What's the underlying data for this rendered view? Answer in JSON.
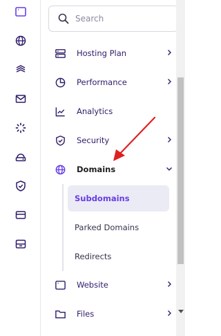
{
  "rail": {
    "icons": [
      "browser-window-icon",
      "globe-icon",
      "layers-icon",
      "mail-icon",
      "loader-icon",
      "cloud-drive-icon",
      "shield-icon",
      "card-icon",
      "storage-box-icon"
    ]
  },
  "search": {
    "placeholder": "Search",
    "value": ""
  },
  "nav": {
    "hosting_plan": "Hosting Plan",
    "performance": "Performance",
    "analytics": "Analytics",
    "security": "Security",
    "domains": "Domains",
    "website": "Website",
    "files": "Files"
  },
  "domains_sub": {
    "subdomains": "Subdomains",
    "parked_domains": "Parked Domains",
    "redirects": "Redirects"
  },
  "colors": {
    "accent": "#673de6",
    "text": "#2f1c6a",
    "selected_bg": "#ebebf5",
    "annotation_arrow": "#e02020"
  }
}
